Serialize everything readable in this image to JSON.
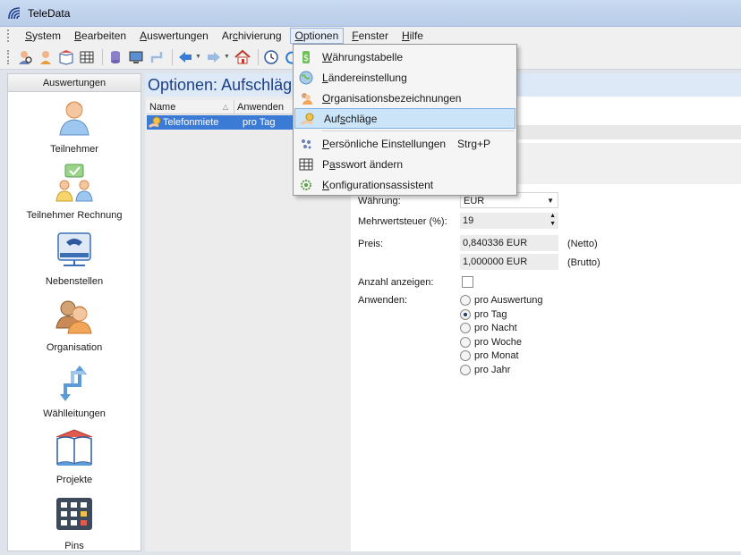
{
  "window": {
    "title": "TeleData"
  },
  "menubar": {
    "items": [
      "System",
      "Bearbeiten",
      "Auswertungen",
      "Archivierung",
      "Optionen",
      "Fenster",
      "Hilfe"
    ],
    "active": "Optionen"
  },
  "toolbar": {
    "icons": [
      "user-search-icon",
      "user-icon",
      "book-icon",
      "table-icon",
      "database-icon",
      "monitor-icon",
      "route-icon",
      "back-arrow-icon",
      "forward-arrow-icon",
      "home-icon",
      "clock-icon",
      "refresh-icon"
    ]
  },
  "leftpanel": {
    "header": "Auswertungen",
    "items": [
      {
        "label": "Teilnehmer",
        "icon": "person-icon"
      },
      {
        "label": "Teilnehmer Rechnung",
        "icon": "people-bill-icon"
      },
      {
        "label": "Nebenstellen",
        "icon": "phone-device-icon"
      },
      {
        "label": "Organisation",
        "icon": "organisation-icon"
      },
      {
        "label": "Wählleitungen",
        "icon": "lines-icon"
      },
      {
        "label": "Projekte",
        "icon": "projects-book-icon"
      },
      {
        "label": "Pins",
        "icon": "keypad-icon"
      }
    ]
  },
  "content": {
    "title": "Optionen: Aufschläge",
    "list": {
      "columns": [
        "Name",
        "Anwenden"
      ],
      "rows": [
        {
          "name": "Telefonmiete",
          "anwenden": "pro Tag"
        }
      ]
    },
    "form": {
      "waehrung_label": "Währung:",
      "waehrung_value": "EUR",
      "mwst_label": "Mehrwertsteuer (%):",
      "mwst_value": "19",
      "preis_label": "Preis:",
      "preis_netto": "0,840336 EUR",
      "netto_label": "(Netto)",
      "preis_brutto": "1,000000 EUR",
      "brutto_label": "(Brutto)",
      "anzahl_label": "Anzahl anzeigen:",
      "anwenden_label": "Anwenden:",
      "anwenden_options": [
        "pro Auswertung",
        "pro Tag",
        "pro Nacht",
        "pro Woche",
        "pro Monat",
        "pro Jahr"
      ],
      "anwenden_selected": "pro Tag"
    }
  },
  "dropdown": {
    "items": [
      {
        "label": "Währungstabelle",
        "ul": "W",
        "icon": "currency-icon"
      },
      {
        "label": "Ländereinstellung",
        "ul": "L",
        "icon": "globe-icon"
      },
      {
        "label": "Organisationsbezeichnungen",
        "ul": "O",
        "icon": "organisation-icon"
      },
      {
        "label": "Aufschläge",
        "ul": "A",
        "icon": "coins-icon",
        "hover": true
      },
      {
        "label": "Persönliche Einstellungen",
        "ul": "P",
        "icon": "settings-dots-icon",
        "shortcut": "Strg+P"
      },
      {
        "label": "Passwort ändern",
        "ul": "a",
        "icon": "password-grid-icon"
      },
      {
        "label": "Konfigurationsassistent",
        "ul": "K",
        "icon": "wizard-gear-icon"
      }
    ]
  }
}
